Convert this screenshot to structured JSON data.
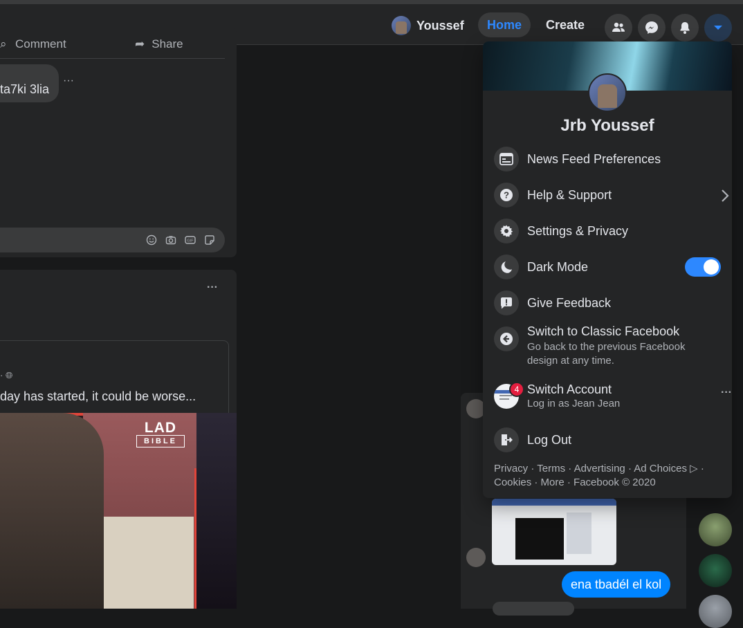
{
  "topbar": {
    "profile_name": "Youssef",
    "home_label": "Home",
    "create_label": "Create"
  },
  "feed": {
    "action_comment": "Comment",
    "action_share": "Share",
    "comment_text": "ta7ki 3lia",
    "comment_more": "···",
    "post_more": "···",
    "shared_text": "day has started, it could be worse...",
    "video_watermark_top": "LAD",
    "video_watermark_bottom": "BIBLE"
  },
  "menu": {
    "user_name": "Jrb Youssef",
    "items": [
      {
        "label": "News Feed Preferences",
        "icon": "news-feed-icon"
      },
      {
        "label": "Help & Support",
        "icon": "help-icon"
      },
      {
        "label": "Settings & Privacy",
        "icon": "gear-icon"
      },
      {
        "label": "Dark Mode",
        "icon": "moon-icon"
      },
      {
        "label": "Give Feedback",
        "icon": "feedback-icon"
      },
      {
        "label": "Switch to Classic Facebook",
        "sub": "Go back to the previous Facebook design at any time.",
        "icon": "back-arrow-icon"
      },
      {
        "label": "Switch Account",
        "sub": "Log in as Jean Jean",
        "icon": "account-thumb",
        "badge": "4"
      },
      {
        "label": "Log Out",
        "icon": "logout-icon"
      }
    ],
    "dark_mode_on": true,
    "footer": "Privacy · Terms · Advertising · Ad Choices ▷ · Cookies · More · Facebook © 2020"
  },
  "chat": {
    "message": "ena tbadél el kol"
  },
  "colors": {
    "accent": "#2d88ff",
    "background": "#18191a",
    "surface": "#242526",
    "badge": "#e41e3f"
  }
}
